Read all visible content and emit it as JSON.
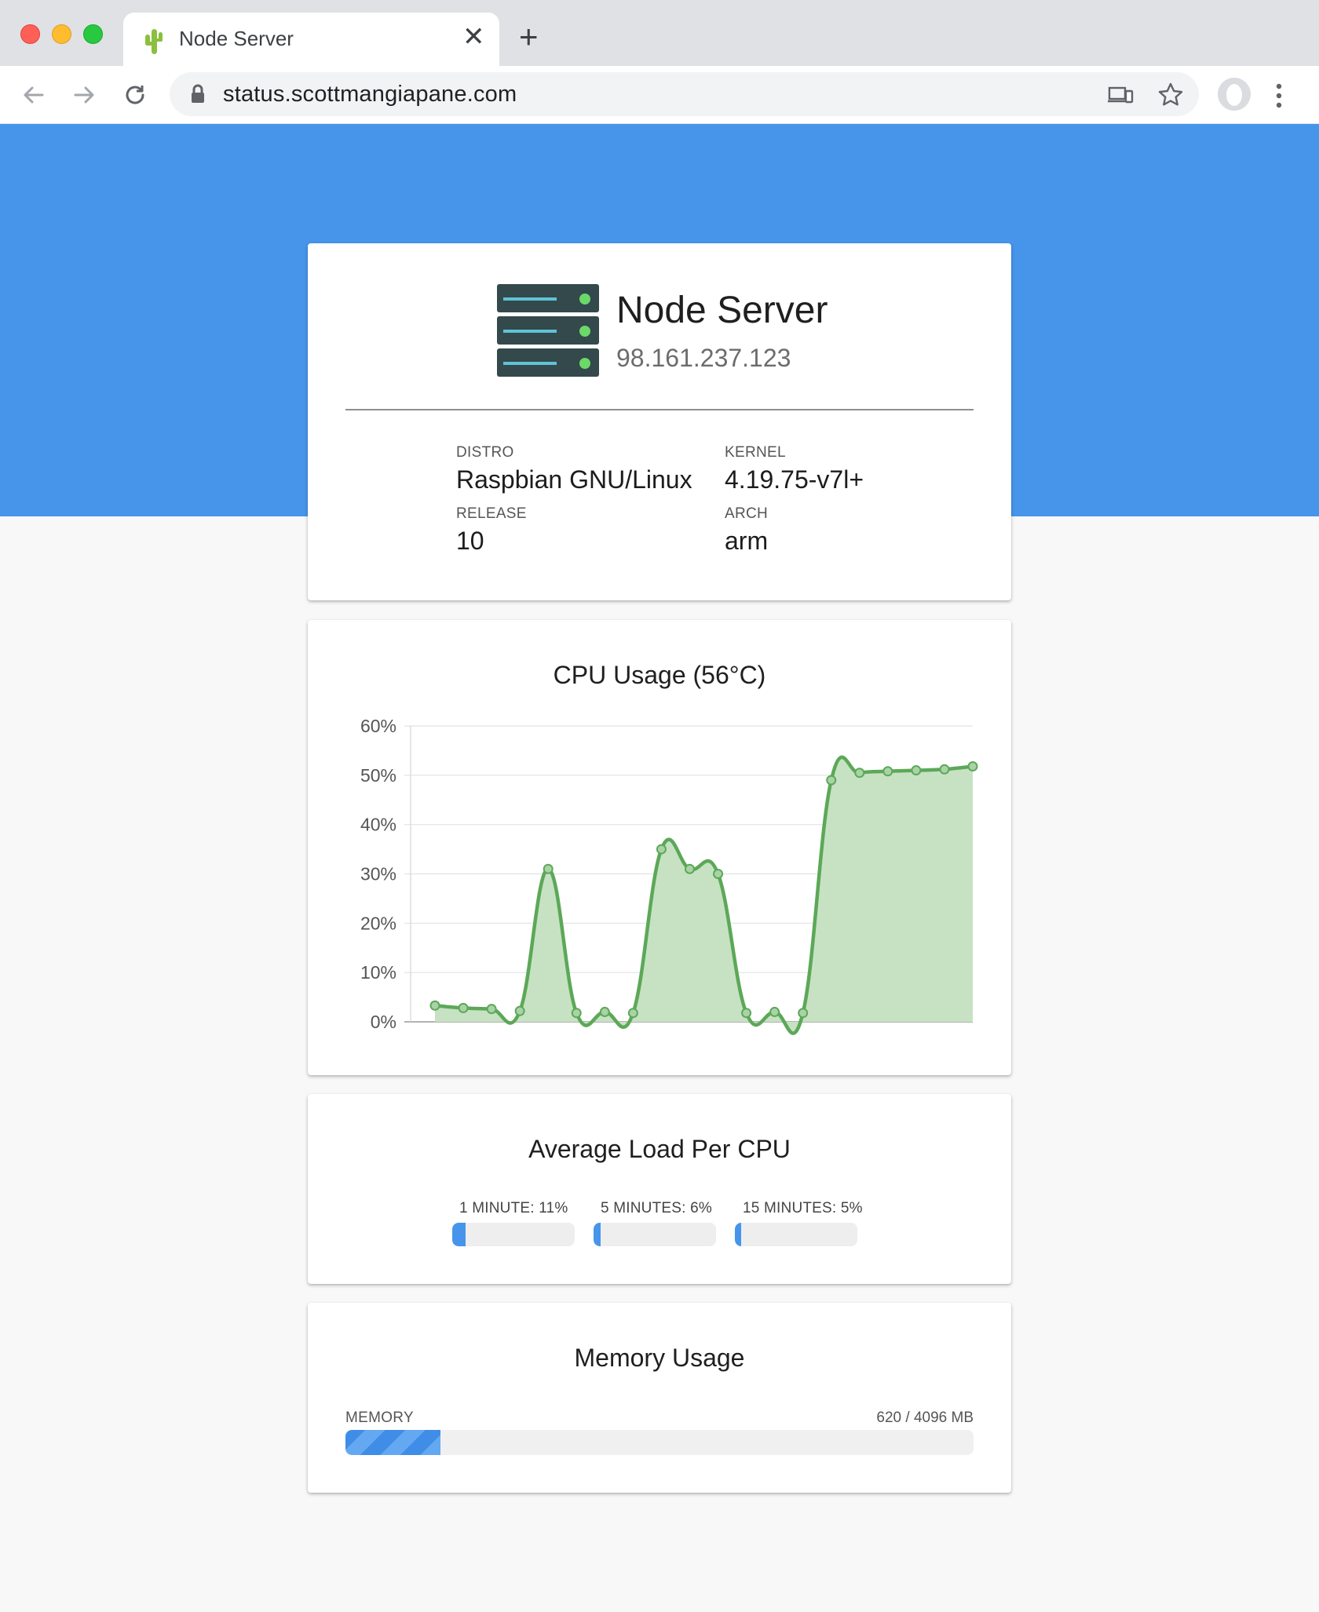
{
  "browser": {
    "tab_title": "Node Server",
    "url": "status.scottmangiapane.com",
    "new_tab_icon": "plus-icon",
    "close_icon": "close-icon"
  },
  "colors": {
    "hero": "#4695eb",
    "chart_line": "#5ca858",
    "chart_fill": "#c6e2c3",
    "bar_fill": "#4695eb"
  },
  "server": {
    "name": "Node Server",
    "ip": "98.161.237.123",
    "icon": "server-rack-icon"
  },
  "info": {
    "distro_label": "DISTRO",
    "distro": "Raspbian GNU/Linux",
    "kernel_label": "KERNEL",
    "kernel": "4.19.75-v7l+",
    "release_label": "RELEASE",
    "release": "10",
    "arch_label": "ARCH",
    "arch": "arm"
  },
  "cpu": {
    "title": "CPU Usage (56°C)"
  },
  "chart_data": {
    "type": "area",
    "title": "CPU Usage (56°C)",
    "xlabel": "",
    "ylabel": "",
    "ylim": [
      0,
      60
    ],
    "ytick_labels": [
      "0%",
      "10%",
      "20%",
      "30%",
      "40%",
      "50%",
      "60%"
    ],
    "grid": true,
    "legend": "none",
    "series": [
      {
        "values": [
          3.3,
          2.8,
          2.6,
          2.2,
          31,
          1.8,
          2,
          1.8,
          35,
          31,
          30,
          1.8,
          2,
          1.8,
          49,
          50.5,
          50.8,
          51,
          51.2,
          51.8
        ]
      }
    ]
  },
  "load": {
    "title": "Average Load Per CPU",
    "items": [
      {
        "label": "1 MINUTE: 11%",
        "value": 11
      },
      {
        "label": "5 MINUTES: 6%",
        "value": 6
      },
      {
        "label": "15 MINUTES: 5%",
        "value": 5
      }
    ]
  },
  "memory": {
    "title": "Memory Usage",
    "label": "MEMORY",
    "value_text": "620 / 4096 MB",
    "used": 620,
    "total": 4096
  }
}
